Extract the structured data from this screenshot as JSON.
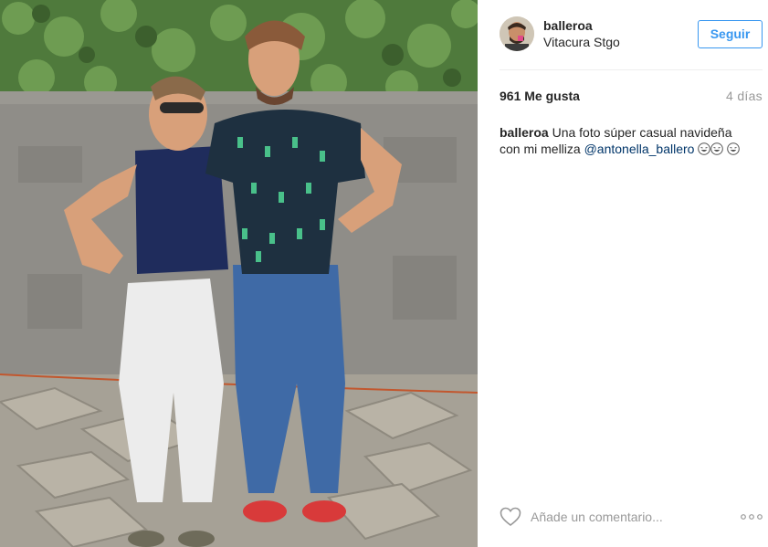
{
  "post": {
    "username": "balleroa",
    "location": "Vitacura Stgo",
    "follow_label": "Seguir",
    "likes": "961 Me gusta",
    "time_ago": "4 días",
    "caption": {
      "user": "balleroa",
      "text": " Una foto súper casual navideña con mi melliza ",
      "mention": "@antonella_ballero"
    },
    "comment_placeholder": "Añade un comentario..."
  },
  "icons": {
    "like": "heart-icon",
    "more": "more-options-icon",
    "emoji": "laughing-emoji"
  },
  "colors": {
    "accent": "#3897f0",
    "mention": "#003569",
    "muted": "#999999",
    "text": "#262626"
  }
}
